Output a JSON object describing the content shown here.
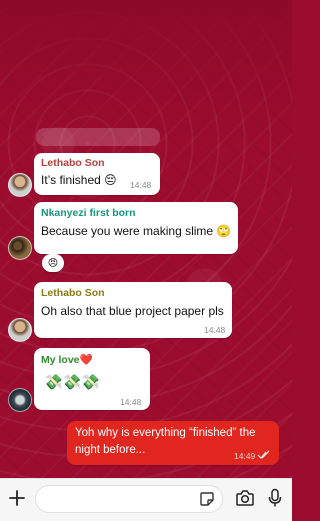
{
  "chat": {
    "messages": [
      {
        "sender": "Lethabo Son",
        "sender_color": "#b2413f",
        "text": "It’s finished 😔",
        "time": "14:48"
      },
      {
        "sender": "Nkanyezi first born",
        "sender_color": "#14977f",
        "text": "Because you were making slime 🙄",
        "reaction": "😠"
      },
      {
        "sender": "Lethabo Son",
        "sender_color": "#8c7a13",
        "text": "Oh also that blue project paper pls",
        "time": "14:48"
      },
      {
        "sender": "My love❤️",
        "sender_color": "#2e8a2e",
        "text": "💸💸💸",
        "time": "14:48"
      },
      {
        "line1": "Yoh why is everything “finished” the",
        "line2": "night before...",
        "time": "14:49",
        "status": "read-ticks-icon"
      }
    ]
  },
  "composer": {
    "attach_icon": "plus-icon",
    "sticker_icon": "sticker-icon",
    "camera_icon": "camera-icon",
    "mic_icon": "microphone-icon"
  },
  "colors": {
    "wallpaper": "#9b0c2f",
    "outgoing": "#e0261e",
    "incoming": "#ffffff"
  }
}
